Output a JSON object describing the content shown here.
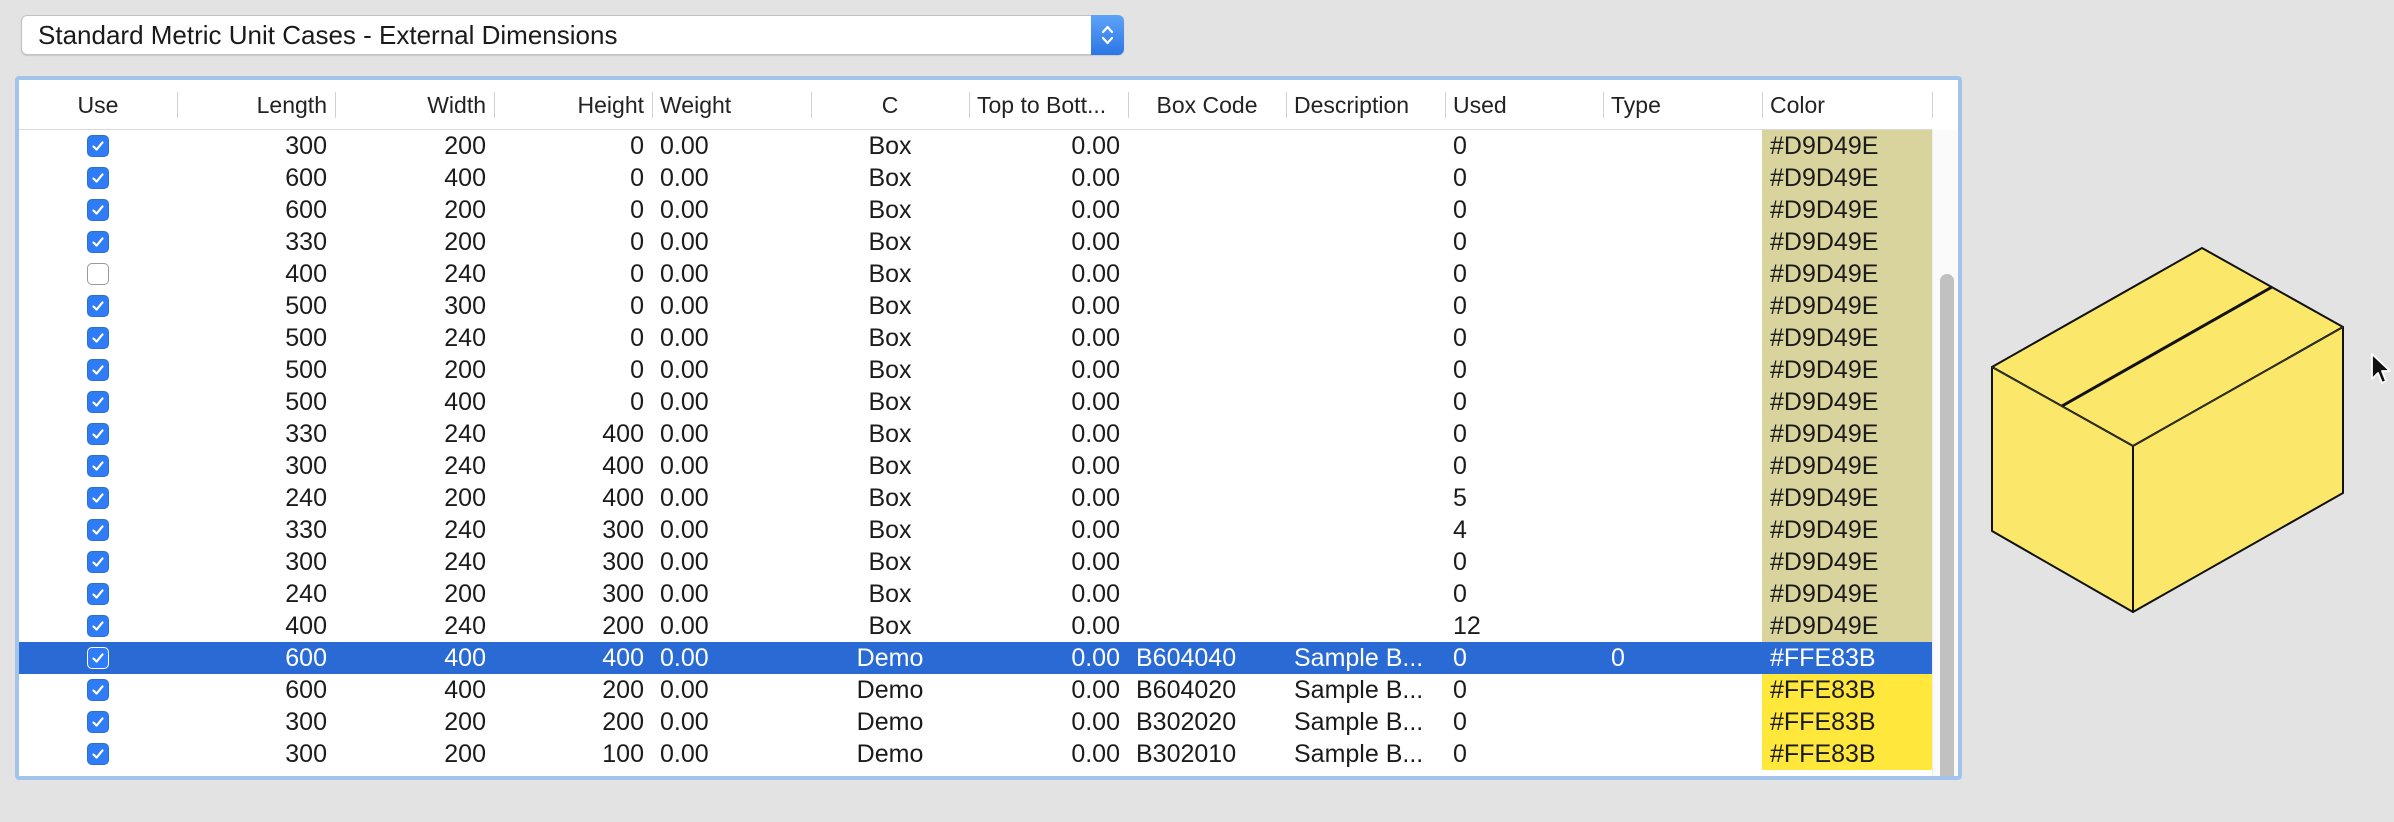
{
  "selector": {
    "selected_value": "Standard Metric Unit Cases - External Dimensions"
  },
  "table": {
    "columns": [
      {
        "key": "use",
        "label": "Use"
      },
      {
        "key": "length",
        "label": "Length"
      },
      {
        "key": "width",
        "label": "Width"
      },
      {
        "key": "height",
        "label": "Height"
      },
      {
        "key": "weight",
        "label": "Weight"
      },
      {
        "key": "c",
        "label": "C"
      },
      {
        "key": "top_to_bottom",
        "label": "Top to Bott..."
      },
      {
        "key": "box_code",
        "label": "Box Code"
      },
      {
        "key": "description",
        "label": "Description"
      },
      {
        "key": "used",
        "label": "Used"
      },
      {
        "key": "type",
        "label": "Type"
      },
      {
        "key": "color",
        "label": "Color"
      }
    ],
    "rows": [
      {
        "use": true,
        "length": "300",
        "width": "200",
        "height": "0",
        "weight": "0.00",
        "c": "Box",
        "top_to_bottom": "0.00",
        "box_code": "",
        "description": "",
        "used": "0",
        "type": "",
        "color": "#D9D49E"
      },
      {
        "use": true,
        "length": "600",
        "width": "400",
        "height": "0",
        "weight": "0.00",
        "c": "Box",
        "top_to_bottom": "0.00",
        "box_code": "",
        "description": "",
        "used": "0",
        "type": "",
        "color": "#D9D49E"
      },
      {
        "use": true,
        "length": "600",
        "width": "200",
        "height": "0",
        "weight": "0.00",
        "c": "Box",
        "top_to_bottom": "0.00",
        "box_code": "",
        "description": "",
        "used": "0",
        "type": "",
        "color": "#D9D49E"
      },
      {
        "use": true,
        "length": "330",
        "width": "200",
        "height": "0",
        "weight": "0.00",
        "c": "Box",
        "top_to_bottom": "0.00",
        "box_code": "",
        "description": "",
        "used": "0",
        "type": "",
        "color": "#D9D49E"
      },
      {
        "use": false,
        "length": "400",
        "width": "240",
        "height": "0",
        "weight": "0.00",
        "c": "Box",
        "top_to_bottom": "0.00",
        "box_code": "",
        "description": "",
        "used": "0",
        "type": "",
        "color": "#D9D49E"
      },
      {
        "use": true,
        "length": "500",
        "width": "300",
        "height": "0",
        "weight": "0.00",
        "c": "Box",
        "top_to_bottom": "0.00",
        "box_code": "",
        "description": "",
        "used": "0",
        "type": "",
        "color": "#D9D49E"
      },
      {
        "use": true,
        "length": "500",
        "width": "240",
        "height": "0",
        "weight": "0.00",
        "c": "Box",
        "top_to_bottom": "0.00",
        "box_code": "",
        "description": "",
        "used": "0",
        "type": "",
        "color": "#D9D49E"
      },
      {
        "use": true,
        "length": "500",
        "width": "200",
        "height": "0",
        "weight": "0.00",
        "c": "Box",
        "top_to_bottom": "0.00",
        "box_code": "",
        "description": "",
        "used": "0",
        "type": "",
        "color": "#D9D49E"
      },
      {
        "use": true,
        "length": "500",
        "width": "400",
        "height": "0",
        "weight": "0.00",
        "c": "Box",
        "top_to_bottom": "0.00",
        "box_code": "",
        "description": "",
        "used": "0",
        "type": "",
        "color": "#D9D49E"
      },
      {
        "use": true,
        "length": "330",
        "width": "240",
        "height": "400",
        "weight": "0.00",
        "c": "Box",
        "top_to_bottom": "0.00",
        "box_code": "",
        "description": "",
        "used": "0",
        "type": "",
        "color": "#D9D49E"
      },
      {
        "use": true,
        "length": "300",
        "width": "240",
        "height": "400",
        "weight": "0.00",
        "c": "Box",
        "top_to_bottom": "0.00",
        "box_code": "",
        "description": "",
        "used": "0",
        "type": "",
        "color": "#D9D49E"
      },
      {
        "use": true,
        "length": "240",
        "width": "200",
        "height": "400",
        "weight": "0.00",
        "c": "Box",
        "top_to_bottom": "0.00",
        "box_code": "",
        "description": "",
        "used": "5",
        "type": "",
        "color": "#D9D49E"
      },
      {
        "use": true,
        "length": "330",
        "width": "240",
        "height": "300",
        "weight": "0.00",
        "c": "Box",
        "top_to_bottom": "0.00",
        "box_code": "",
        "description": "",
        "used": "4",
        "type": "",
        "color": "#D9D49E"
      },
      {
        "use": true,
        "length": "300",
        "width": "240",
        "height": "300",
        "weight": "0.00",
        "c": "Box",
        "top_to_bottom": "0.00",
        "box_code": "",
        "description": "",
        "used": "0",
        "type": "",
        "color": "#D9D49E"
      },
      {
        "use": true,
        "length": "240",
        "width": "200",
        "height": "300",
        "weight": "0.00",
        "c": "Box",
        "top_to_bottom": "0.00",
        "box_code": "",
        "description": "",
        "used": "0",
        "type": "",
        "color": "#D9D49E"
      },
      {
        "use": true,
        "length": "400",
        "width": "240",
        "height": "200",
        "weight": "0.00",
        "c": "Box",
        "top_to_bottom": "0.00",
        "box_code": "",
        "description": "",
        "used": "12",
        "type": "",
        "color": "#D9D49E"
      },
      {
        "use": true,
        "length": "600",
        "width": "400",
        "height": "400",
        "weight": "0.00",
        "c": "Demo",
        "top_to_bottom": "0.00",
        "box_code": "B604040",
        "description": "Sample B...",
        "used": "0",
        "type": "0",
        "color": "#FFE83B",
        "selected": true
      },
      {
        "use": true,
        "length": "600",
        "width": "400",
        "height": "200",
        "weight": "0.00",
        "c": "Demo",
        "top_to_bottom": "0.00",
        "box_code": "B604020",
        "description": "Sample B...",
        "used": "0",
        "type": "",
        "color": "#FFE83B"
      },
      {
        "use": true,
        "length": "300",
        "width": "200",
        "height": "200",
        "weight": "0.00",
        "c": "Demo",
        "top_to_bottom": "0.00",
        "box_code": "B302020",
        "description": "Sample B...",
        "used": "0",
        "type": "",
        "color": "#FFE83B"
      },
      {
        "use": true,
        "length": "300",
        "width": "200",
        "height": "100",
        "weight": "0.00",
        "c": "Demo",
        "top_to_bottom": "0.00",
        "box_code": "B302010",
        "description": "Sample B...",
        "used": "0",
        "type": "",
        "color": "#FFE83B"
      }
    ]
  },
  "preview": {
    "icon": "box-3d-icon",
    "fill_color": "#FBE76A"
  },
  "colors": {
    "accent": "#2A6AD4",
    "selection": "#2A6AD4",
    "focus_ring": "#A2C3EC"
  }
}
